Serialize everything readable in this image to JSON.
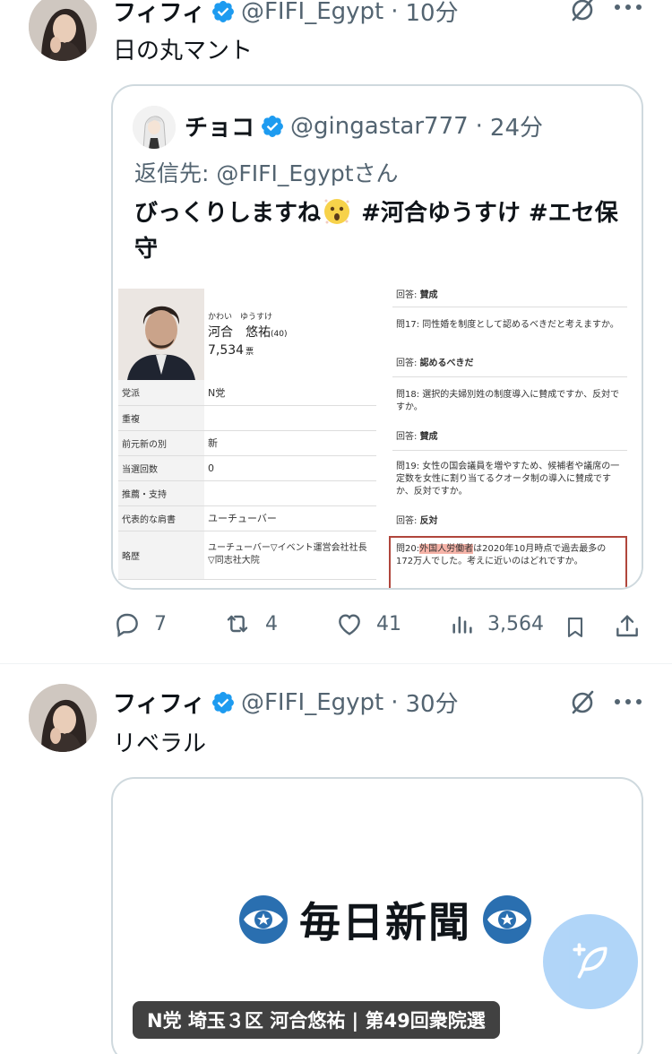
{
  "tweet1": {
    "author": "フィフィ",
    "handle": "@FIFI_Egypt",
    "time": "10分",
    "text": "日の丸マント",
    "quote": {
      "author": "チョコ",
      "handle": "@gingastar777",
      "time": "24分",
      "reply_prefix": "返信先: ",
      "reply_handle": "@FIFI_Egypt",
      "reply_suffix": "さん",
      "text_a": "びっくりしますね",
      "text_b": " #河合ゆうすけ #エセ保守",
      "doc": {
        "furigana": "かわい　ゆうすけ",
        "candidate_name": "河合　悠祐",
        "age": "(40)",
        "votes": "7,534",
        "votes_unit": "票",
        "rows": [
          {
            "key": "党派",
            "value": "N党"
          },
          {
            "key": "重複",
            "value": ""
          },
          {
            "key": "前元新の別",
            "value": "新"
          },
          {
            "key": "当選回数",
            "value": "0"
          },
          {
            "key": "推薦・支持",
            "value": ""
          },
          {
            "key": "代表的な肩書",
            "value": "ユーチューバー"
          },
          {
            "key": "略歴",
            "value": "ユーチューバー▽イベント運営会社社長▽同志社大院"
          }
        ],
        "right": {
          "a0_label": "回答:",
          "a0": "賛成",
          "q17": "問17: 同性婚を制度として認めるべきだと考えますか。",
          "a17_label": "回答:",
          "a17": "認めるべきだ",
          "q18": "問18: 選択的夫婦別姓の制度導入に賛成ですか、反対ですか。",
          "a18_label": "回答:",
          "a18": "賛成",
          "q19": "問19: 女性の国会議員を増やすため、候補者や議席の一定数を女性に割り当てるクオータ制の導入に賛成ですか、反対ですか。",
          "a19_label": "回答:",
          "a19": "反対",
          "q20_label": "問20:",
          "q20_highlight": "外国人労働者",
          "q20_rest": "は2020年10月時点で過去最多の172万人でした。考えに近いのはどれですか。"
        }
      }
    },
    "actions": {
      "replies": "7",
      "retweets": "4",
      "likes": "41",
      "views": "3,564"
    }
  },
  "tweet2": {
    "author": "フィフィ",
    "handle": "@FIFI_Egypt",
    "time": "30分",
    "text": "リベラル",
    "card": {
      "logo_text": "毎日新聞",
      "caption": "N党 埼玉３区 河合悠祐 | 第49回衆院選"
    }
  },
  "colors": {
    "verified": "#1d9bf0",
    "muted": "#536471",
    "fab": "#a3cef7",
    "highlight": "#f6b3a8",
    "box_border": "#b0463c"
  }
}
